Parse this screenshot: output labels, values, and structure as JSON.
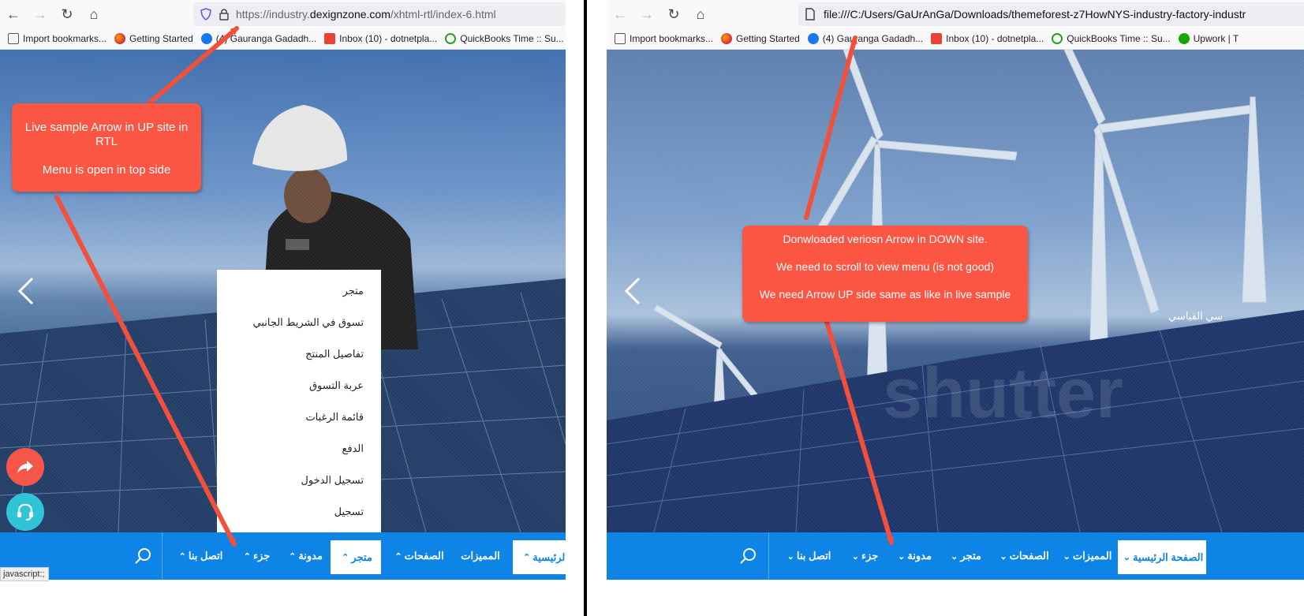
{
  "left": {
    "url_prefix": "https://industry.",
    "url_domain": "dexignzone.com",
    "url_path": "/xhtml-rtl/index-6.html",
    "bookmarks": [
      "Import bookmarks...",
      "Getting Started",
      "(4) Gauranga Gadadh...",
      "Inbox (10) - dotnetpla...",
      "QuickBooks Time :: Su..."
    ],
    "nav_items": [
      "الرئيسية",
      "المميزات",
      "الصفحات",
      "متجر",
      "مدونة",
      "جزء",
      "اتصل بنا"
    ],
    "dropdown_items": [
      "متجر",
      "تسوق في الشريط الجانبي",
      "تفاصيل المنتج",
      "عربة التسوق",
      "قائمة الرغبات",
      "الدفع",
      "تسجيل الدخول",
      "تسجيل"
    ],
    "status_text": "javascript:;",
    "callout_line1": "Live sample Arrow in UP site in RTL",
    "callout_line2": "Menu is open in top side"
  },
  "right": {
    "url": "file:///C:/Users/GaUrAnGa/Downloads/themeforest-z7HowNYS-industry-factory-industr",
    "bookmarks": [
      "Import bookmarks...",
      "Getting Started",
      "(4) Gauranga Gadadh...",
      "Inbox (10) - dotnetpla...",
      "QuickBooks Time :: Su...",
      "Upwork | T"
    ],
    "nav_items": [
      "الصفحة الرئيسية",
      "المميزات",
      "الصفحات",
      "متجر",
      "مدونة",
      "جزء",
      "اتصل بنا"
    ],
    "hero_text": "سي القياسي",
    "watermark": "shutter",
    "callout_line1": "Donwloaded veriosn Arrow in DOWN site.",
    "callout_line2": "We need to scroll to view menu (is not good)",
    "callout_line3": "We need Arrow UP side same as like in live sample"
  },
  "colors": {
    "nav_blue": "#0d84e6",
    "callout_red": "#fb5543",
    "share_button": "#f4574a",
    "support_button": "#31c3d6"
  }
}
